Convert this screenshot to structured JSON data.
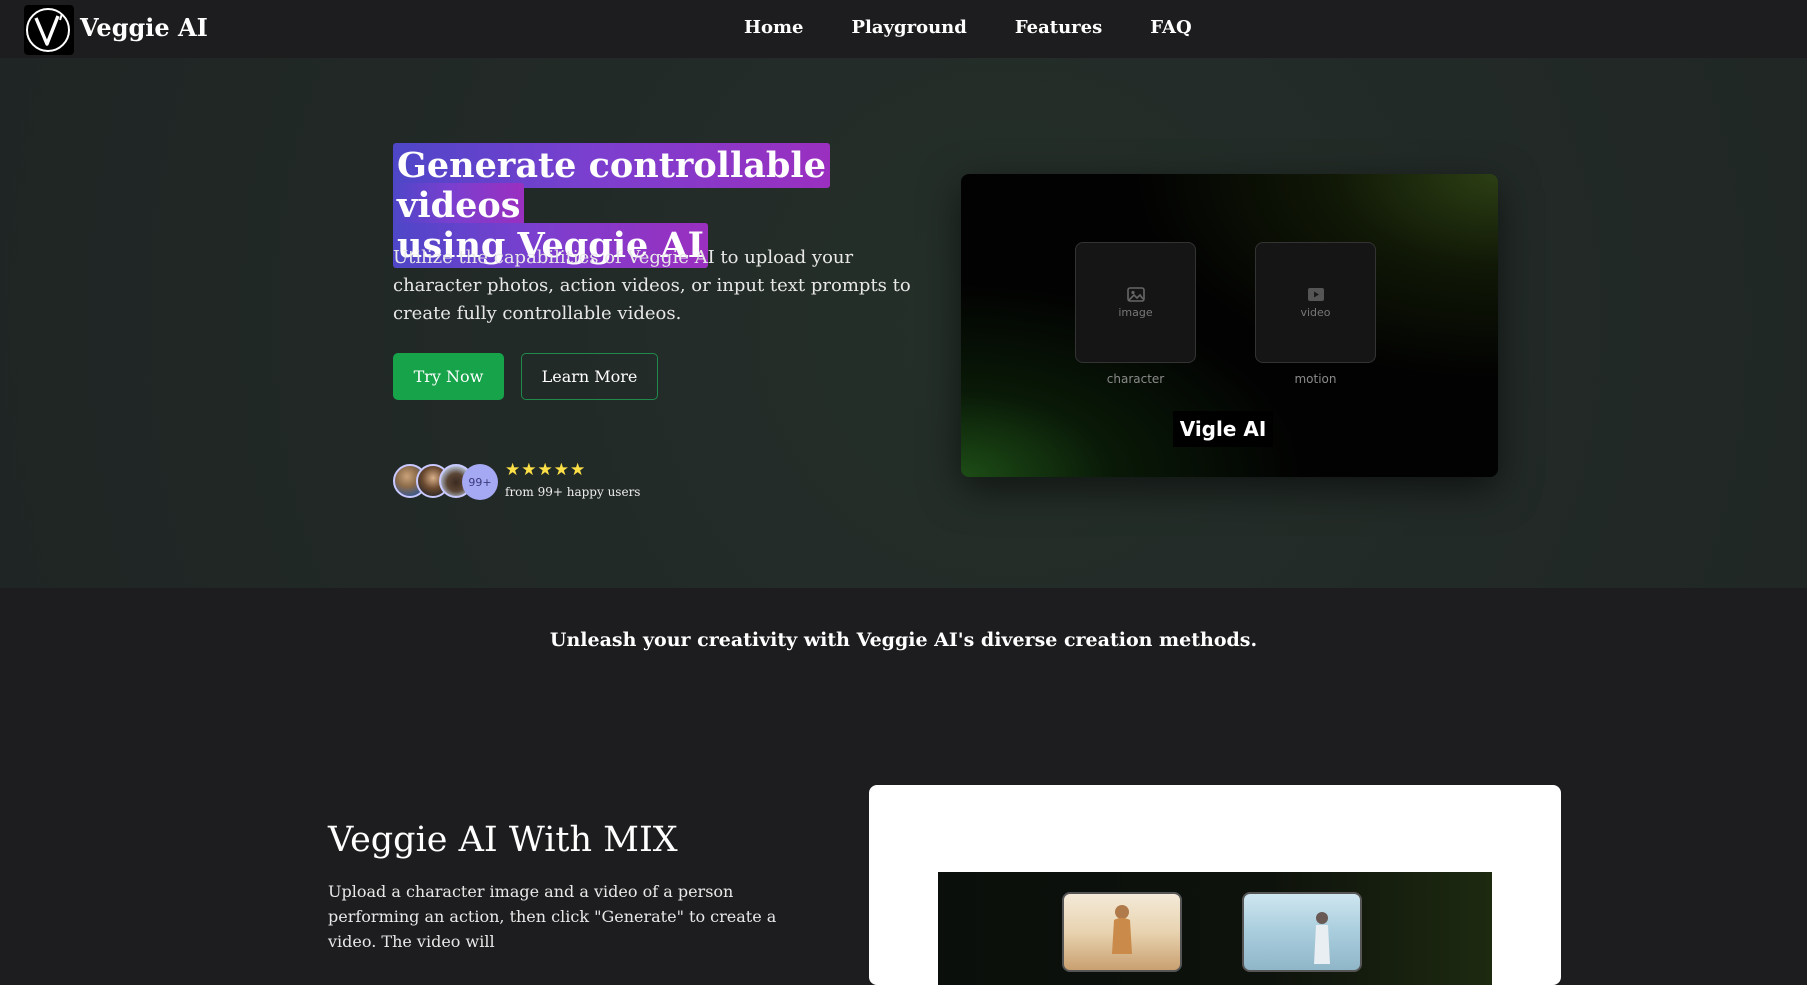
{
  "brand": {
    "name": "Veggie AI",
    "logo_letter": "V"
  },
  "nav": {
    "items": [
      "Home",
      "Playground",
      "Features",
      "FAQ"
    ]
  },
  "hero": {
    "title_line1": "Generate controllable videos",
    "title_line2": "using Veggie AI",
    "subtitle": "Utilize the capabilities of Veggie AI to upload your character photos, action videos, or input text prompts to create fully controllable videos.",
    "try_label": "Try Now",
    "learn_label": "Learn More",
    "avatar_count": "99+",
    "stars": "★★★★★",
    "rating": 5,
    "users_text": "from 99+ happy users"
  },
  "preview": {
    "image_slot_label": "image",
    "video_slot_label": "video",
    "character_caption": "character",
    "motion_caption": "motion",
    "brand_text": "Vigle AI"
  },
  "section": {
    "tagline": "Unleash your creativity with Veggie AI's diverse creation methods.",
    "mix_title": "Veggie AI With MIX",
    "mix_desc": "Upload a character image and a video of a person performing an action, then click \"Generate\" to create a video. The video will"
  },
  "colors": {
    "accent_green": "#16a34a",
    "highlight_start": "#4e46c8",
    "highlight_end": "#9a2fc0",
    "star_yellow": "#fde047"
  }
}
